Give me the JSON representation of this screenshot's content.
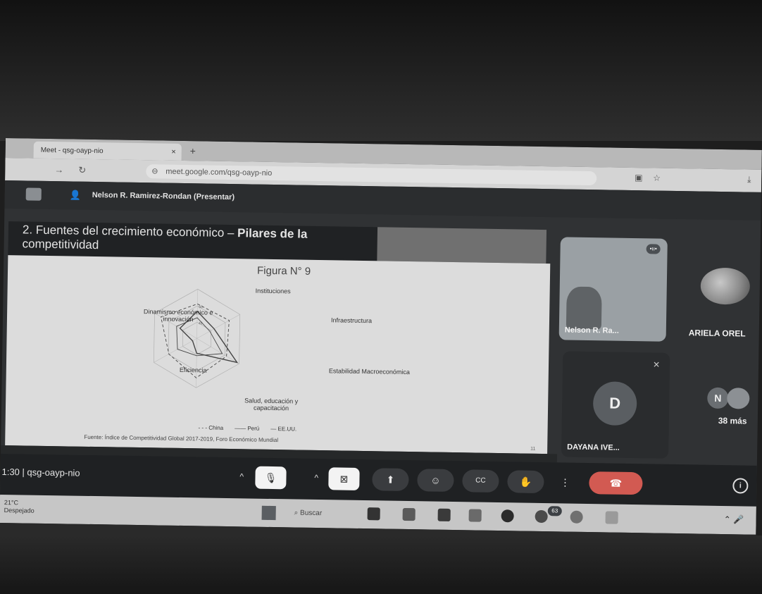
{
  "browser": {
    "tab_title": "Meet - qsg-oayp-nio",
    "tab_close": "×",
    "new_tab": "+",
    "url": "meet.google.com/qsg-oayp-nio"
  },
  "meet": {
    "presenter": "Nelson R. Ramirez-Rondan (Presentar)",
    "meeting_code": "1:30 | qsg-oayp-nio"
  },
  "slide": {
    "title_plain": "2. Fuentes del crecimiento económico – ",
    "title_bold": "Pilares de la",
    "title_line2": "competitividad",
    "figure_caption": "Figura N° 9",
    "source": "Fuente: Índice de Competitividad Global 2017-2019, Foro Económico Mundial",
    "page_num": "11"
  },
  "chart_data": {
    "type": "radar",
    "title": "Figura N° 9",
    "axes": [
      "Instituciones",
      "Infraestructura",
      "Estabilidad Macroeconómica",
      "Salud, educación y capacitación",
      "Eficiencia",
      "Dinamismo económico e innovación"
    ],
    "series": [
      {
        "name": "China",
        "style": "dashed",
        "values": [
          70,
          75,
          70,
          80,
          65,
          85
        ]
      },
      {
        "name": "Perú",
        "style": "solid",
        "values": [
          55,
          40,
          95,
          30,
          10,
          40
        ]
      },
      {
        "name": "EE.UU.",
        "style": "solid-thin",
        "values": [
          42,
          30,
          60,
          35,
          45,
          48
        ]
      }
    ],
    "rings": [
      "60",
      "40"
    ],
    "legend_position": "bottom"
  },
  "participants": [
    {
      "name": "Nelson R. Ra...",
      "video": true
    },
    {
      "name": "ARIELA OREL"
    },
    {
      "name": "DAYANA IVE...",
      "initial": "D"
    }
  ],
  "more": {
    "initial": "N",
    "label": "38 más"
  },
  "controls": {
    "mic": "🎙",
    "camera": "⊠",
    "present": "⬆",
    "emoji": "☺",
    "captions": "CC",
    "hand": "✋",
    "more": "⋮",
    "end": "☎",
    "caret": "^",
    "info": "i"
  },
  "taskbar": {
    "weather_temp": "21°C",
    "weather_desc": "Despejado",
    "search": "Buscar",
    "badge": "63"
  }
}
